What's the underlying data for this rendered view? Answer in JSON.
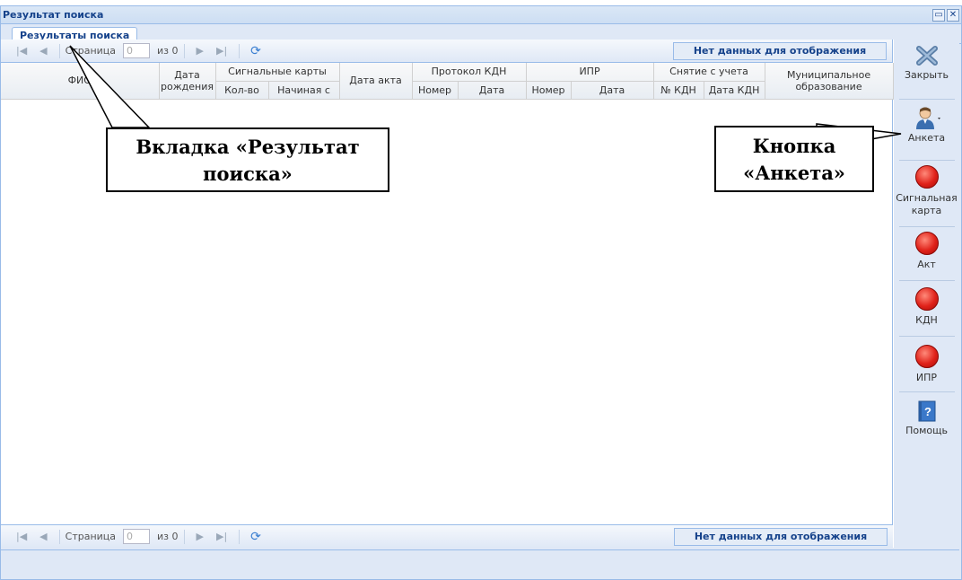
{
  "window": {
    "title": "Результат поиска"
  },
  "tab": {
    "label": "Результаты поиска"
  },
  "pager": {
    "page_label": "Страница",
    "page_value": "0",
    "of_label": "из 0",
    "status": "Нет данных для отображения"
  },
  "columns": {
    "fio": "ФИО",
    "birth_date": "Дата рождения",
    "signal_cards": "Сигнальные карты",
    "count": "Кол-во",
    "starting_from": "Начиная с",
    "act_date": "Дата акта",
    "kdn_protocol": "Протокол КДН",
    "kdn_number": "Номер",
    "kdn_date": "Дата",
    "ipr": "ИПР",
    "ipr_number": "Номер",
    "ipr_date": "Дата",
    "deregistration": "Снятие с учета",
    "kdn_no": "№ КДН",
    "kdn_date2": "Дата КДН",
    "municipality": "Муниципальное образование"
  },
  "sidebar": {
    "close": "Закрыть",
    "anketa": "Анкета",
    "signal_card": "Сигнальная карта",
    "act": "Акт",
    "kdn": "КДН",
    "ipr": "ИПР",
    "help": "Помощь"
  },
  "annotations": {
    "tab_callout": "Вкладка «Результат поиска»",
    "button_callout": "Кнопка «Анкета»"
  },
  "colors": {
    "accent": "#15428b",
    "panel": "#dfe8f6",
    "border": "#99bbe8"
  }
}
